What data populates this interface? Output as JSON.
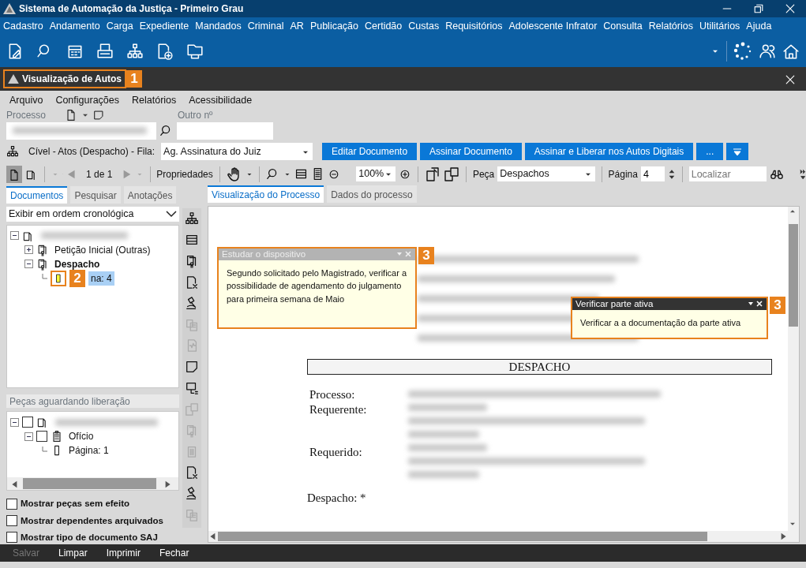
{
  "window": {
    "title": "Sistema de Automação da Justiça - Primeiro Grau"
  },
  "main_menu": [
    "Cadastro",
    "Andamento",
    "Carga",
    "Expediente",
    "Mandados",
    "Criminal",
    "AR",
    "Publicação",
    "Certidão",
    "Custas",
    "Requisitórios",
    "Adolescente Infrator",
    "Consulta",
    "Relatórios",
    "Utilitários",
    "Ajuda"
  ],
  "tab": {
    "title": "Visualização de Autos",
    "callout": "1"
  },
  "sub_menu": [
    "Arquivo",
    "Configurações",
    "Relatórios",
    "Acessibilidade"
  ],
  "process": {
    "label": "Processo",
    "other_label": "Outro nº"
  },
  "queue": {
    "label": "Cível - Atos (Despacho) - Fila:",
    "value": "Ag. Assinatura do Juiz"
  },
  "action_buttons": [
    "Editar Documento",
    "Assinar Documento",
    "Assinar e Liberar nos Autos Digitais",
    "..."
  ],
  "viewer_toolbar": {
    "page_count": "1 de 1",
    "properties": "Propriedades",
    "zoom": "100%",
    "piece_label": "Peça",
    "piece_value": "Despachos",
    "page_label": "Página",
    "page_value": "4",
    "find_placeholder": "Localizar"
  },
  "left_tabs": [
    {
      "label": "Documentos",
      "selected": true
    },
    {
      "label": "Pesquisar",
      "selected": false
    },
    {
      "label": "Anotações",
      "selected": false
    }
  ],
  "order_select": "Exibir em ordem cronológica",
  "doc_tree": [
    {
      "kind": "folder",
      "expanded": true,
      "selected": false,
      "children": [
        {
          "kind": "certificate",
          "label": "Petição Inicial (Outras)",
          "expanded": false,
          "bold": false,
          "selected": false
        },
        {
          "kind": "certificate",
          "label": "Despacho",
          "expanded": true,
          "bold": true,
          "selected": false,
          "children": [
            {
              "kind": "page",
              "label": "na: 4",
              "selected": true,
              "callout": "2"
            }
          ]
        }
      ]
    }
  ],
  "pending": {
    "title": "Peças aguardando liberação",
    "tree": [
      {
        "kind": "folder",
        "expanded": true,
        "checked": false,
        "selected": false,
        "children": [
          {
            "kind": "clipboard",
            "label": "Ofício",
            "expanded": true,
            "checked": false,
            "selected": false,
            "children": [
              {
                "kind": "page",
                "label": "Página: 1",
                "selected": false
              }
            ]
          }
        ]
      }
    ]
  },
  "options": [
    {
      "label": "Mostrar peças sem efeito",
      "checked": false
    },
    {
      "label": "Mostrar dependentes arquivados",
      "checked": false
    },
    {
      "label": "Mostrar tipo de documento SAJ",
      "checked": false
    }
  ],
  "doc_tabs": [
    {
      "label": "Visualização do Processo",
      "selected": true
    },
    {
      "label": "Dados do processo",
      "selected": false
    }
  ],
  "document": {
    "heading": "DESPACHO",
    "fields": [
      "Processo:",
      "Requerente:",
      "Requerido:"
    ],
    "closing": "Despacho: *"
  },
  "notes": [
    {
      "title": "Estudar o dispositivo",
      "body": "Segundo solicitado pelo Magistrado, verificar a possibilidade de agendamento do julgamento para primeira semana de Maio",
      "active": false,
      "callout": "3"
    },
    {
      "title": "Verificar parte ativa",
      "body": "Verificar a a documentação da parte ativa",
      "active": true,
      "callout": "3"
    }
  ],
  "footer": [
    {
      "label": "Salvar",
      "disabled": true
    },
    {
      "label": "Limpar",
      "disabled": false
    },
    {
      "label": "Imprimir",
      "disabled": false
    },
    {
      "label": "Fechar",
      "disabled": false
    }
  ]
}
